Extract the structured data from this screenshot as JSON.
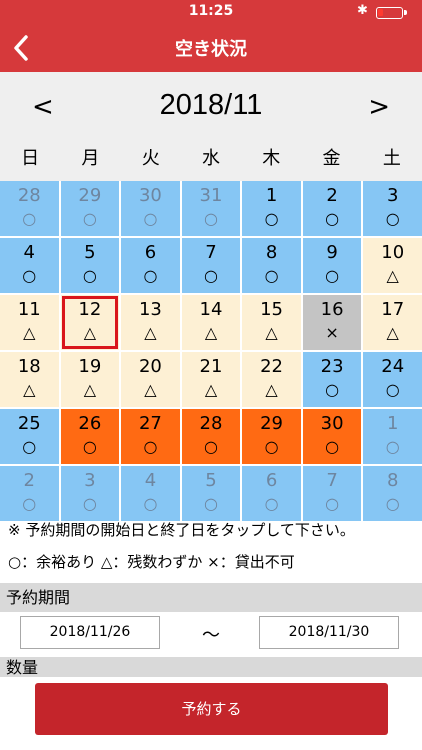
{
  "status_bar": {
    "time": "11:25"
  },
  "nav": {
    "title": "空き状況"
  },
  "calendar": {
    "month_label": "2018/11",
    "prev_label": "<",
    "next_label": ">",
    "weekdays": [
      "日",
      "月",
      "火",
      "水",
      "木",
      "金",
      "土"
    ],
    "cells": [
      {
        "day": "28",
        "mark": "○",
        "status": "avail",
        "other_month": true
      },
      {
        "day": "29",
        "mark": "○",
        "status": "avail",
        "other_month": true
      },
      {
        "day": "30",
        "mark": "○",
        "status": "avail",
        "other_month": true
      },
      {
        "day": "31",
        "mark": "○",
        "status": "avail",
        "other_month": true
      },
      {
        "day": "1",
        "mark": "○",
        "status": "avail"
      },
      {
        "day": "2",
        "mark": "○",
        "status": "avail"
      },
      {
        "day": "3",
        "mark": "○",
        "status": "avail"
      },
      {
        "day": "4",
        "mark": "○",
        "status": "avail"
      },
      {
        "day": "5",
        "mark": "○",
        "status": "avail"
      },
      {
        "day": "6",
        "mark": "○",
        "status": "avail"
      },
      {
        "day": "7",
        "mark": "○",
        "status": "avail"
      },
      {
        "day": "8",
        "mark": "○",
        "status": "avail"
      },
      {
        "day": "9",
        "mark": "○",
        "status": "avail"
      },
      {
        "day": "10",
        "mark": "△",
        "status": "few"
      },
      {
        "day": "11",
        "mark": "△",
        "status": "few"
      },
      {
        "day": "12",
        "mark": "△",
        "status": "few",
        "today": true
      },
      {
        "day": "13",
        "mark": "△",
        "status": "few"
      },
      {
        "day": "14",
        "mark": "△",
        "status": "few"
      },
      {
        "day": "15",
        "mark": "△",
        "status": "few"
      },
      {
        "day": "16",
        "mark": "×",
        "status": "none"
      },
      {
        "day": "17",
        "mark": "△",
        "status": "few"
      },
      {
        "day": "18",
        "mark": "△",
        "status": "few"
      },
      {
        "day": "19",
        "mark": "△",
        "status": "few"
      },
      {
        "day": "20",
        "mark": "△",
        "status": "few"
      },
      {
        "day": "21",
        "mark": "△",
        "status": "few"
      },
      {
        "day": "22",
        "mark": "△",
        "status": "few"
      },
      {
        "day": "23",
        "mark": "○",
        "status": "avail"
      },
      {
        "day": "24",
        "mark": "○",
        "status": "avail"
      },
      {
        "day": "25",
        "mark": "○",
        "status": "avail"
      },
      {
        "day": "26",
        "mark": "○",
        "status": "selected"
      },
      {
        "day": "27",
        "mark": "○",
        "status": "selected"
      },
      {
        "day": "28",
        "mark": "○",
        "status": "selected"
      },
      {
        "day": "29",
        "mark": "○",
        "status": "selected"
      },
      {
        "day": "30",
        "mark": "○",
        "status": "selected"
      },
      {
        "day": "1",
        "mark": "○",
        "status": "avail",
        "other_month": true
      },
      {
        "day": "2",
        "mark": "○",
        "status": "avail",
        "other_month": true
      },
      {
        "day": "3",
        "mark": "○",
        "status": "avail",
        "other_month": true
      },
      {
        "day": "4",
        "mark": "○",
        "status": "avail",
        "other_month": true
      },
      {
        "day": "5",
        "mark": "○",
        "status": "avail",
        "other_month": true
      },
      {
        "day": "6",
        "mark": "○",
        "status": "avail",
        "other_month": true
      },
      {
        "day": "7",
        "mark": "○",
        "status": "avail",
        "other_month": true
      },
      {
        "day": "8",
        "mark": "○",
        "status": "avail",
        "other_month": true
      }
    ]
  },
  "notes": {
    "instruction": "※ 予約期間の開始日と終了日をタップして下さい。",
    "legend": "○：余裕あり △：残数わずか ×：貸出不可"
  },
  "period": {
    "header": "予約期間",
    "start_date": "2018/11/26",
    "separator": "～",
    "end_date": "2018/11/30"
  },
  "quantity": {
    "header": "数量"
  },
  "actions": {
    "reserve_label": "予約する"
  },
  "colors": {
    "brand_red": "#d6393b",
    "available": "#86c6f4",
    "few_left": "#fdf0d4",
    "unavailable": "#c4c4c4",
    "selected_range": "#ff6a13"
  }
}
